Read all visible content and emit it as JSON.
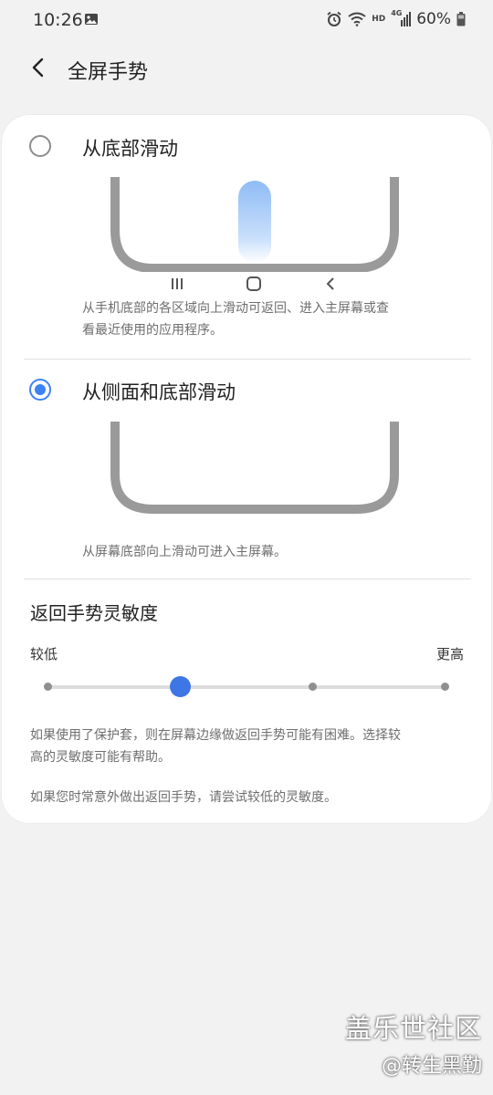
{
  "status": {
    "time": "10:26",
    "battery_text": "60%",
    "icons": [
      "gallery-icon",
      "alarm-icon",
      "wifi-icon",
      "hd-icon",
      "signal-icon",
      "battery-icon"
    ],
    "hd_label": "HD",
    "network_label": "4G"
  },
  "header": {
    "back_icon": "chevron-left-icon",
    "title": "全屏手势"
  },
  "options": [
    {
      "label": "从底部滑动",
      "selected": false,
      "description_line1": "从手机底部的各区域向上滑动可返回、进入主屏幕或查",
      "description_line2": "看最近使用的应用程序。",
      "nav_keys": [
        "recents-icon",
        "home-icon",
        "back-icon"
      ]
    },
    {
      "label": "从侧面和底部滑动",
      "selected": true,
      "description_line1": "从屏幕底部向上滑动可进入主屏幕。"
    }
  ],
  "sensitivity": {
    "title": "返回手势灵敏度",
    "low_label": "较低",
    "high_label": "更高",
    "stops": 4,
    "current_stop_index": 1,
    "accent_color": "#3e76e6",
    "help_text_1_line1": "如果使用了保护套，则在屏幕边缘做返回手势可能有困难。选择较",
    "help_text_1_line2": "高的灵敏度可能有帮助。",
    "help_text_2": "如果您时常意外做出返回手势，请尝试较低的灵敏度。"
  },
  "watermark": {
    "line1": "盖乐世社区",
    "line2": "@转生黑勤"
  }
}
